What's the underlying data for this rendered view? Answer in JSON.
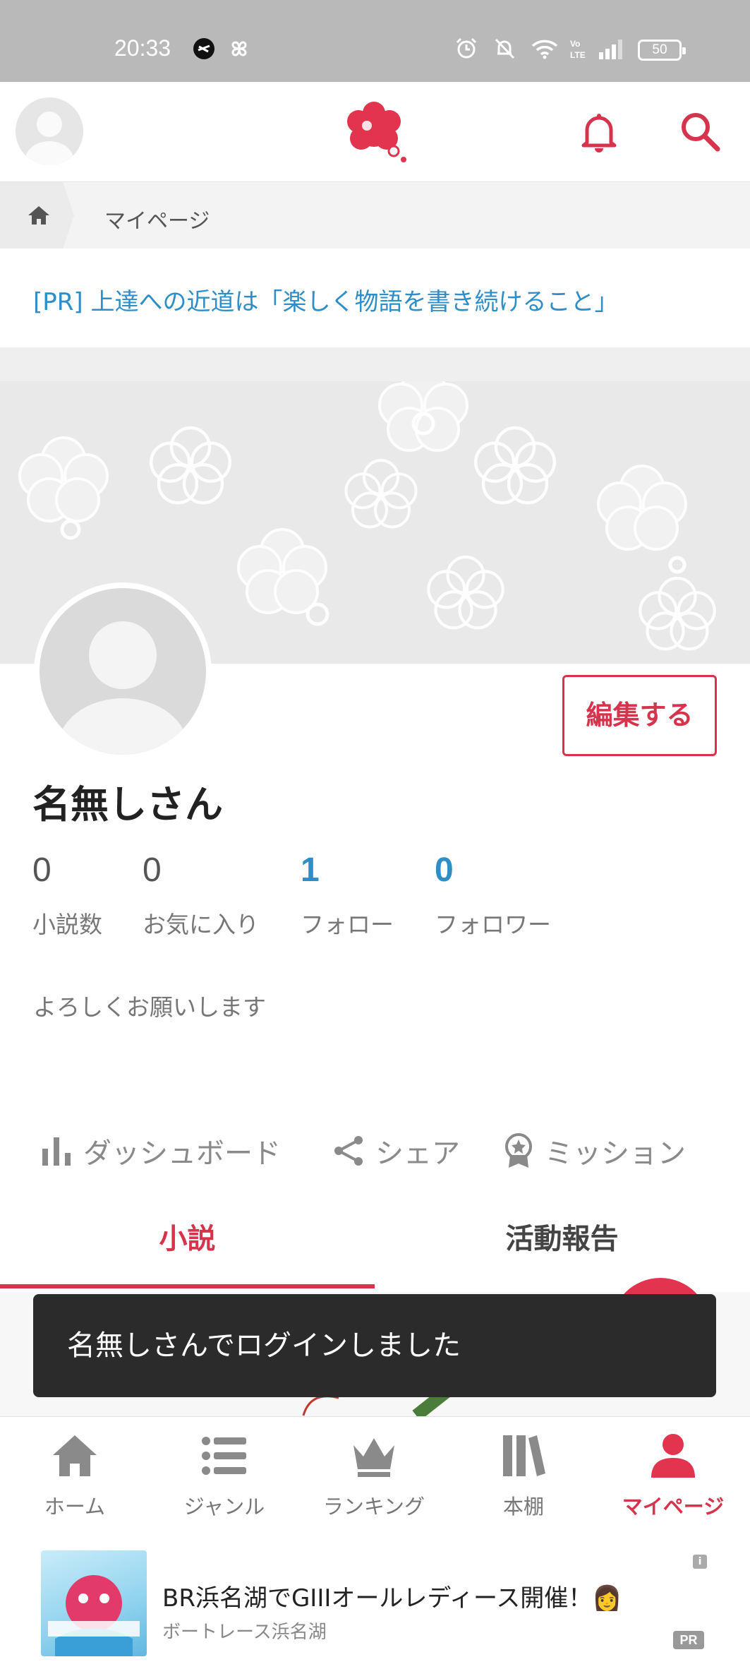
{
  "status_bar": {
    "time": "20:33",
    "battery": "50",
    "icons": [
      "app-circle-icon",
      "pinwheel-icon",
      "alarm-icon",
      "mute-icon",
      "wifi-icon",
      "volte-icon",
      "signal-icon",
      "battery-icon"
    ]
  },
  "header": {
    "icons": [
      "avatar-icon",
      "logo-icon",
      "bell-icon",
      "search-icon"
    ],
    "accent_color": "#d6334d"
  },
  "breadcrumb": {
    "home_icon": "home-icon",
    "current": "マイページ"
  },
  "pr_banner": {
    "text": "[PR] 上達への近道は「楽しく物語を書き続けること」"
  },
  "profile": {
    "edit_label": "編集する",
    "name": "名無しさん",
    "stats": [
      {
        "value": "0",
        "label": "小説数"
      },
      {
        "value": "0",
        "label": "お気に入り"
      },
      {
        "value": "1",
        "label": "フォロー"
      },
      {
        "value": "0",
        "label": "フォロワー"
      }
    ],
    "bio": "よろしくお願いします"
  },
  "actions": {
    "dashboard": "ダッシュボード",
    "share": "シェア",
    "mission": "ミッション"
  },
  "tabs": {
    "novels": "小説",
    "activity": "活動報告"
  },
  "toast": {
    "message": "名無しさんでログインしました"
  },
  "bottom_nav": {
    "home": "ホーム",
    "genre": "ジャンル",
    "ranking": "ランキング",
    "bookshelf": "本棚",
    "mypage": "マイページ"
  },
  "ad": {
    "title": "BR浜名湖でGIIIオールレディース開催！👩",
    "sponsor": "ボートレース浜名湖",
    "info_badge": "i",
    "pr_badge": "PR"
  }
}
